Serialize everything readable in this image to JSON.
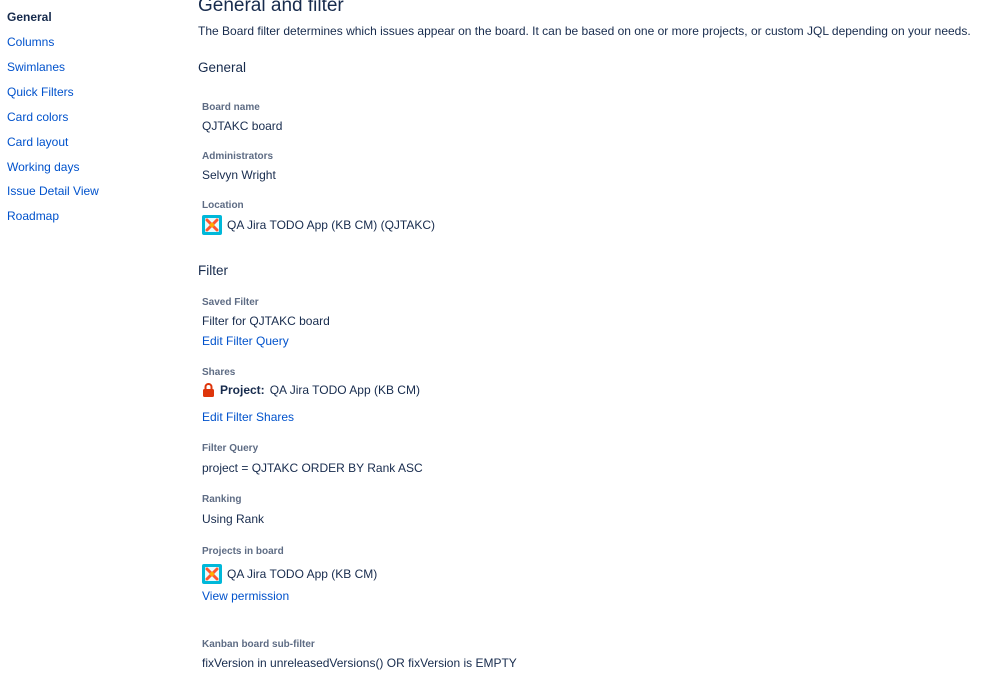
{
  "sidebar": {
    "items": [
      {
        "label": "General",
        "active": true
      },
      {
        "label": "Columns"
      },
      {
        "label": "Swimlanes"
      },
      {
        "label": "Quick Filters"
      },
      {
        "label": "Card colors"
      },
      {
        "label": "Card layout"
      },
      {
        "label": "Working days"
      },
      {
        "label": "Issue Detail View"
      },
      {
        "label": "Roadmap"
      }
    ]
  },
  "main": {
    "title": "General and filter",
    "description": "The Board filter determines which issues appear on the board. It can be based on one or more projects, or custom JQL depending on your needs.",
    "general": {
      "heading": "General",
      "board_name_label": "Board name",
      "board_name_value": "QJTAKC board",
      "administrators_label": "Administrators",
      "administrators_value": "Selvyn Wright",
      "location_label": "Location",
      "location_value": "QA Jira TODO App (KB CM) (QJTAKC)"
    },
    "filter": {
      "heading": "Filter",
      "saved_filter_label": "Saved Filter",
      "saved_filter_value": "Filter for QJTAKC board",
      "edit_filter_query_link": "Edit Filter Query",
      "shares_label": "Shares",
      "shares_prefix": "Project:",
      "shares_value": "QA Jira TODO App (KB CM)",
      "edit_filter_shares_link": "Edit Filter Shares",
      "filter_query_label": "Filter Query",
      "filter_query_value": "project = QJTAKC ORDER BY Rank ASC",
      "ranking_label": "Ranking",
      "ranking_value": "Using Rank",
      "projects_label": "Projects in board",
      "projects_value": "QA Jira TODO App (KB CM)",
      "view_permission_link": "View permission",
      "subfilter_label": "Kanban board sub-filter",
      "subfilter_value": "fixVersion in unreleasedVersions() OR fixVersion is EMPTY"
    }
  },
  "colors": {
    "link": "#0052cc",
    "text": "#172b4d",
    "label": "#5e6c84",
    "avatar_bg": "#00b8d9",
    "avatar_accent": "#ff5630",
    "lock": "#de350b"
  },
  "icons": {
    "project_avatar": "project-avatar-icon",
    "shares_lock": "lock-icon"
  }
}
